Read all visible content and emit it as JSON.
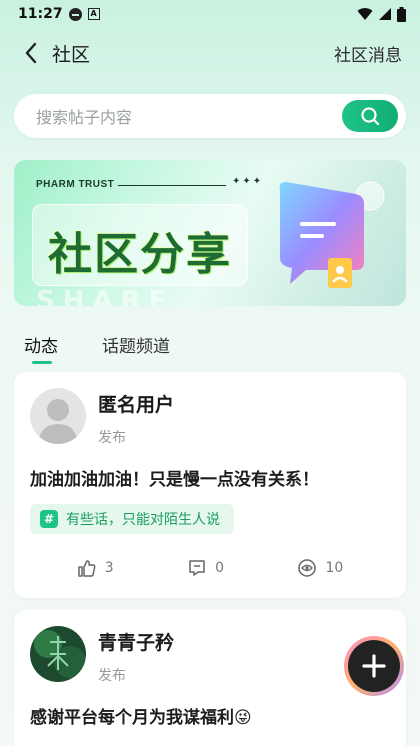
{
  "status_bar": {
    "time": "11:27"
  },
  "header": {
    "title": "社区",
    "messages_label": "社区消息"
  },
  "search": {
    "placeholder": "搜索帖子内容"
  },
  "banner": {
    "brand": "PHARM TRUST",
    "stars": "✦✦✦",
    "title": "社区分享",
    "ghost_text": "SHARE"
  },
  "tabs": [
    {
      "label": "动态",
      "active": true
    },
    {
      "label": "话题频道",
      "active": false
    }
  ],
  "posts": [
    {
      "user": "匿名用户",
      "sub": "发布",
      "text": "加油加油加油！只是慢一点没有关系！",
      "topic": "有些话，只能对陌生人说",
      "likes": "3",
      "comments": "0",
      "views": "10"
    },
    {
      "user": "青青子矜",
      "sub": "发布",
      "text": "感谢平台每个月为我谋福利😜"
    }
  ],
  "colors": {
    "accent": "#1ec487",
    "tag_bg": "#e6f8ee"
  },
  "fab": {
    "icon": "plus-icon"
  }
}
